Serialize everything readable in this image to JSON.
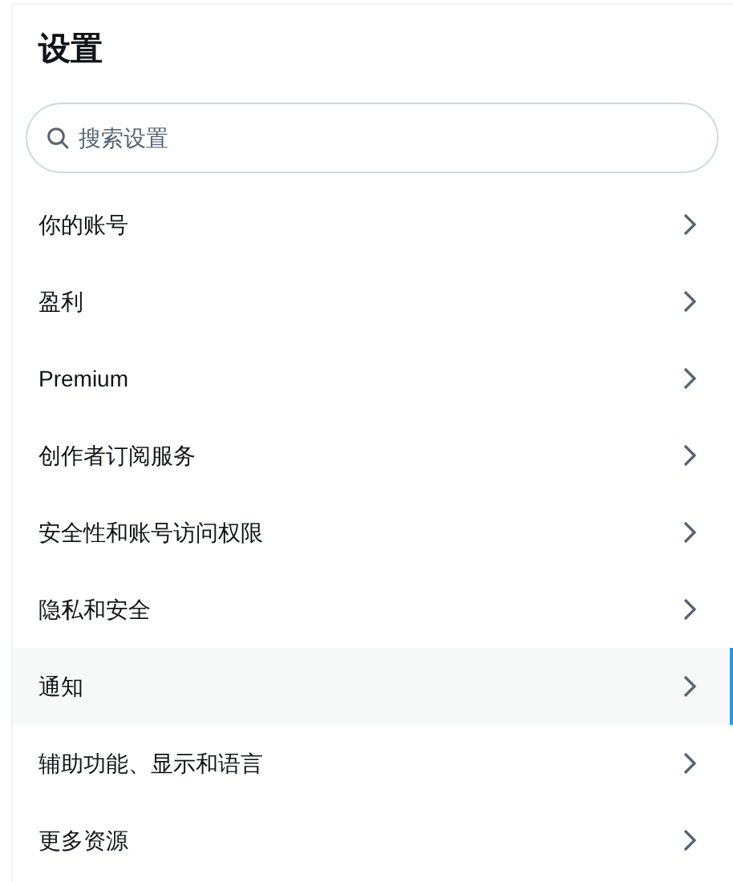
{
  "title": "设置",
  "search": {
    "placeholder": "搜索设置"
  },
  "items": [
    {
      "label": "你的账号",
      "selected": false
    },
    {
      "label": "盈利",
      "selected": false
    },
    {
      "label": "Premium",
      "selected": false
    },
    {
      "label": "创作者订阅服务",
      "selected": false
    },
    {
      "label": "安全性和账号访问权限",
      "selected": false
    },
    {
      "label": "隐私和安全",
      "selected": false
    },
    {
      "label": "通知",
      "selected": true
    },
    {
      "label": "辅助功能、显示和语言",
      "selected": false
    },
    {
      "label": "更多资源",
      "selected": false
    }
  ]
}
